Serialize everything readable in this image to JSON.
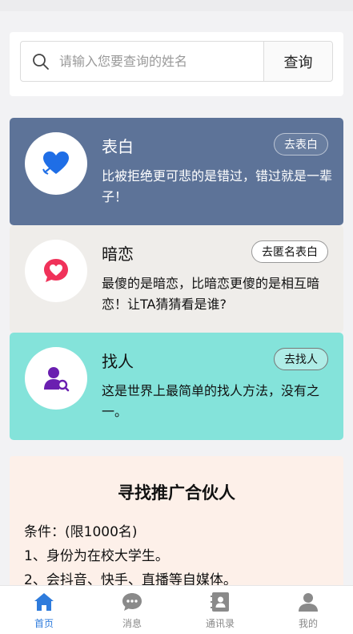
{
  "search": {
    "placeholder": "请输入您要查询的姓名",
    "button_label": "查询"
  },
  "features": [
    {
      "title": "表白",
      "button_label": "去表白",
      "description": "比被拒绝更可悲的是错过，错过就是一辈子！",
      "icon": "heart-arrow-icon",
      "bg_color": "#5d7398",
      "icon_color": "#1f6ee6"
    },
    {
      "title": "暗恋",
      "button_label": "去匿名表白",
      "description": "最傻的是暗恋，比暗恋更傻的是相互暗恋！让TA猜猜看是谁?",
      "icon": "heart-bubble-icon",
      "bg_color": "#efedea",
      "icon_color": "#f0325a"
    },
    {
      "title": "找人",
      "button_label": "去找人",
      "description": "这是世界上最简单的找人方法，没有之一。",
      "icon": "person-search-icon",
      "bg_color": "#84e3da",
      "icon_color": "#6a1fb0"
    }
  ],
  "partner": {
    "title": "寻找推广合伙人",
    "lines": [
      "条件：(限1000名)",
      "1、身份为在校大学生。",
      "2、会抖音、快手、直播等自媒体。"
    ]
  },
  "tabs": [
    {
      "label": "首页",
      "icon": "home-icon",
      "active": true
    },
    {
      "label": "消息",
      "icon": "chat-icon",
      "active": false
    },
    {
      "label": "通讯录",
      "icon": "contacts-icon",
      "active": false
    },
    {
      "label": "我的",
      "icon": "profile-icon",
      "active": false
    }
  ],
  "colors": {
    "accent": "#2e7bdc",
    "inactive_tab": "#888888"
  }
}
